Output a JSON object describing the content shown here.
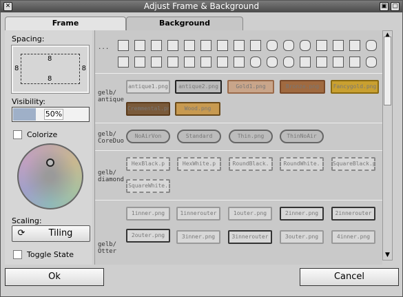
{
  "window": {
    "title": "Adjust Frame & Background"
  },
  "tabs": [
    "Frame",
    "Background"
  ],
  "left": {
    "spacing_label": "Spacing:",
    "spacing_values": {
      "top": "8",
      "left": "8",
      "right": "8",
      "bottom": "8"
    },
    "visibility_label": "Visibility:",
    "visibility_value": "50%",
    "colorize_label": "Colorize",
    "scaling_label": "Scaling:",
    "scaling_value": "Tiling",
    "toggle_label": "Toggle State"
  },
  "rows": [
    {
      "label": "..."
    },
    {
      "label": "gelb/\nantique",
      "items": [
        "antique1.png",
        "antique2.png",
        "Gold1.png",
        "Bronze.png",
        "Fancygold.png",
        "Cremmental.png",
        "Wood.png"
      ]
    },
    {
      "label": "gelb/\nCoreDuo",
      "items": [
        "NoAirVon",
        "Standard",
        "Thin.png",
        "ThinNoAir"
      ]
    },
    {
      "label": "gelb/\ndiamond",
      "items": [
        "HexBlack.p",
        "HexWhite.p",
        "RoundBlack.",
        "RoundWhite.",
        "SquareBlack.p",
        "SquareWhite."
      ]
    },
    {
      "label": "gelb/\nOtter",
      "items": [
        "1inner.png",
        "1innerouter",
        "1outer.png",
        "2inner.png",
        "2innerouter",
        "2outer.png",
        "3inner.png",
        "3innerouter",
        "3outer.png",
        "4inner.png"
      ]
    }
  ],
  "buttons": {
    "ok": "Ok",
    "cancel": "Cancel"
  }
}
